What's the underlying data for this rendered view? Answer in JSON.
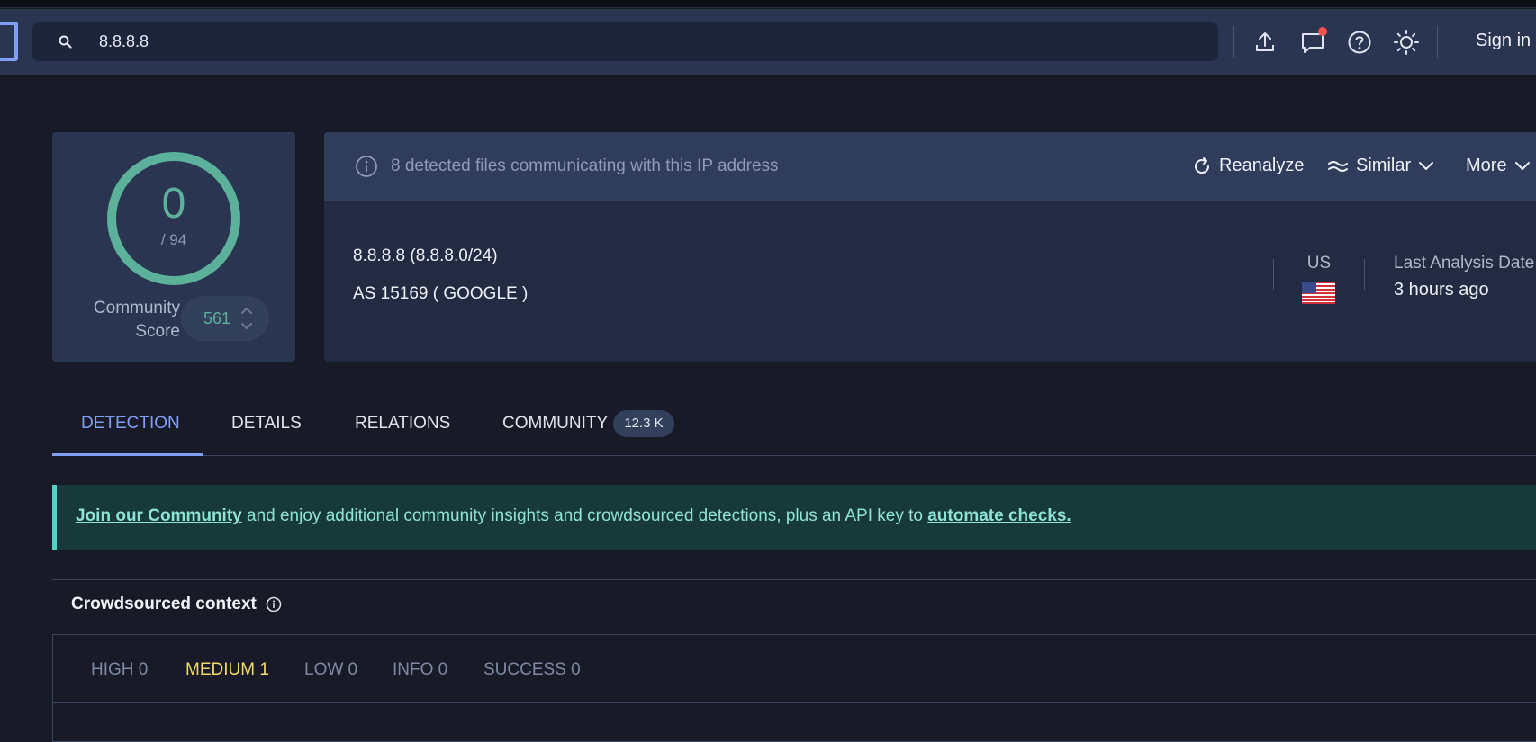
{
  "header": {
    "search_value": "8.8.8.8",
    "sign_in": "Sign in"
  },
  "score": {
    "detections": "0",
    "total": "/ 94",
    "community_label": "Community Score",
    "community_value": "561"
  },
  "info": {
    "message": "8 detected files communicating with this IP address",
    "reanalyze": "Reanalyze",
    "similar": "Similar",
    "more": "More",
    "ip_line": "8.8.8.8  (8.8.8.0/24)",
    "as_line": "AS 15169   ( GOOGLE )",
    "country": "US",
    "last_analysis_label": "Last Analysis Date",
    "last_analysis_value": "3 hours ago"
  },
  "tabs": [
    {
      "label": "DETECTION"
    },
    {
      "label": "DETAILS"
    },
    {
      "label": "RELATIONS"
    },
    {
      "label": "COMMUNITY",
      "badge": "12.3 K"
    }
  ],
  "banner": {
    "link1": "Join our Community",
    "middle": " and enjoy additional community insights and crowdsourced detections, plus an API key to ",
    "link2": "automate checks."
  },
  "crowdsourced": {
    "title": "Crowdsourced context",
    "levels": [
      {
        "label": "HIGH 0"
      },
      {
        "label": "MEDIUM 1"
      },
      {
        "label": "LOW 0"
      },
      {
        "label": "INFO 0"
      },
      {
        "label": "SUCCESS 0"
      }
    ]
  },
  "colors": {
    "accent": "#7ea1f5",
    "score_green": "#5cb19a",
    "banner_text": "#8fe3d6",
    "medium_yellow": "#f2d96b",
    "notification": "#f4524d"
  }
}
